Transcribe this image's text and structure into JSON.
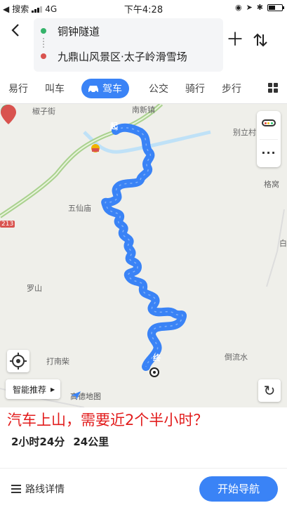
{
  "status_bar": {
    "back_app": "搜索",
    "network": "4G",
    "time": "下午4:28"
  },
  "route": {
    "start": "铜钟隧道",
    "end": "九鼎山风景区·太子岭滑雪场",
    "start_color": "#35b36a",
    "end_color": "#d9534f"
  },
  "tabs": [
    {
      "label": "易行"
    },
    {
      "label": "叫车"
    },
    {
      "label": "驾车",
      "active": true
    },
    {
      "label": "公交"
    },
    {
      "label": "骑行"
    },
    {
      "label": "步行"
    }
  ],
  "map": {
    "labels": {
      "l1": "椒子街",
      "l2": "南新镇",
      "l3": "别立村",
      "l4": "格窝",
      "l5": "五仙庙",
      "l6": "罗山",
      "l7": "打南柴",
      "l8": "倒流水",
      "l9": "白"
    },
    "road_badge": "213",
    "start_marker": "起",
    "end_marker": "终",
    "route_color": "#3a83f6",
    "smart_recommend": "智能推荐",
    "logo": "高德地图"
  },
  "annotation": "汽车上山，需要近2个半小时？",
  "summary": {
    "duration": "2小时24分",
    "distance": "24公里"
  },
  "footer": {
    "details": "路线详情",
    "start_nav": "开始导航"
  }
}
